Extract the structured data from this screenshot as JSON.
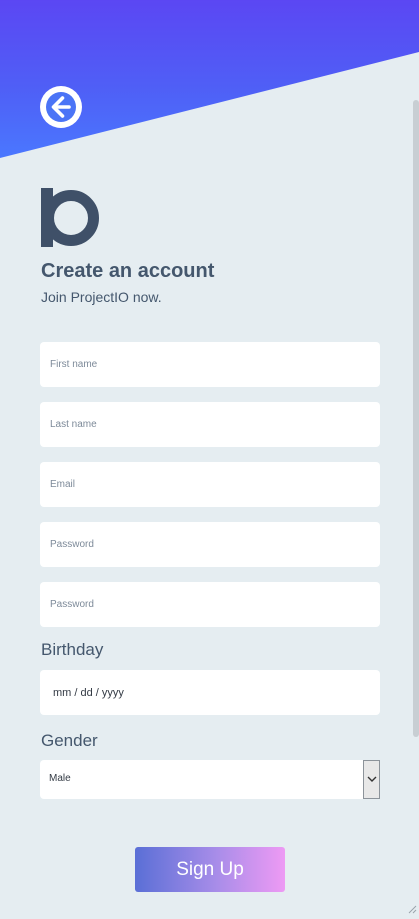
{
  "header": {
    "back_icon": "arrow-left-icon"
  },
  "logo": {
    "icon": "projectio-logo-icon"
  },
  "form": {
    "title": "Create an account",
    "subtitle": "Join ProjectIO now.",
    "first_name_placeholder": "First name",
    "last_name_placeholder": "Last name",
    "email_placeholder": "Email",
    "password_placeholder": "Password",
    "confirm_password_placeholder": "Password",
    "birthday_label": "Birthday",
    "birthday_value": "mm / dd / yyyy",
    "gender_label": "Gender",
    "gender_value": "Male",
    "submit_label": "Sign Up"
  },
  "colors": {
    "header_gradient_start": "#5b47f3",
    "header_gradient_end": "#4a78ff",
    "background": "#e5edf1",
    "text": "#44576d",
    "button_gradient_start": "#5a6fd6",
    "button_gradient_end": "#ee9af4"
  }
}
